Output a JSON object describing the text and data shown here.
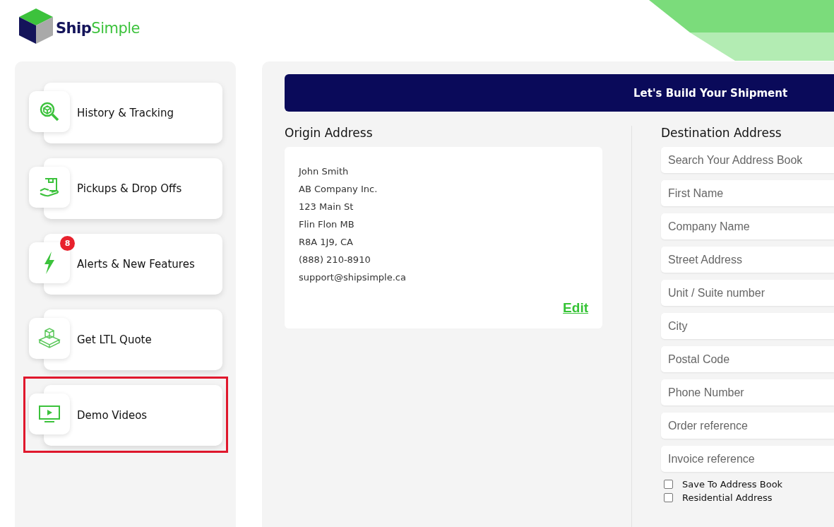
{
  "logo": {
    "part_1": "Ship",
    "part_2": "Simple"
  },
  "sidebar": {
    "items": [
      {
        "kind": "history",
        "label": "History & Tracking",
        "highlighted": false
      },
      {
        "kind": "pickups",
        "label": "Pickups & Drop Offs",
        "highlighted": false
      },
      {
        "kind": "alerts",
        "label": "Alerts & New Features",
        "badge": "8",
        "highlighted": false
      },
      {
        "kind": "ltl",
        "label": "Get LTL Quote",
        "highlighted": false
      },
      {
        "kind": "video",
        "label": "Demo Videos",
        "highlighted": true
      }
    ]
  },
  "header": {
    "title": "Let's Build Your Shipment"
  },
  "origin": {
    "title": "Origin Address",
    "lines": [
      "John Smith",
      "AB Company Inc.",
      "123 Main St",
      "Flin Flon MB",
      "R8A 1J9, CA",
      "(888) 210-8910",
      "support@shipsimple.ca"
    ],
    "edit": "Edit"
  },
  "destination": {
    "title": "Destination Address",
    "fields": [
      {
        "placeholder": "Search Your Address Book"
      },
      {
        "placeholder": "First Name"
      },
      {
        "placeholder": "Company Name"
      },
      {
        "placeholder": "Street Address"
      },
      {
        "placeholder": "Unit / Suite number"
      },
      {
        "placeholder": "City"
      },
      {
        "placeholder": "Postal Code"
      },
      {
        "placeholder": "Phone Number"
      },
      {
        "placeholder": "Order reference"
      },
      {
        "placeholder": "Invoice reference"
      }
    ],
    "checkboxes": [
      {
        "label": "Save To Address Book",
        "checked": false
      },
      {
        "label": "Residential Address",
        "checked": false
      }
    ]
  }
}
